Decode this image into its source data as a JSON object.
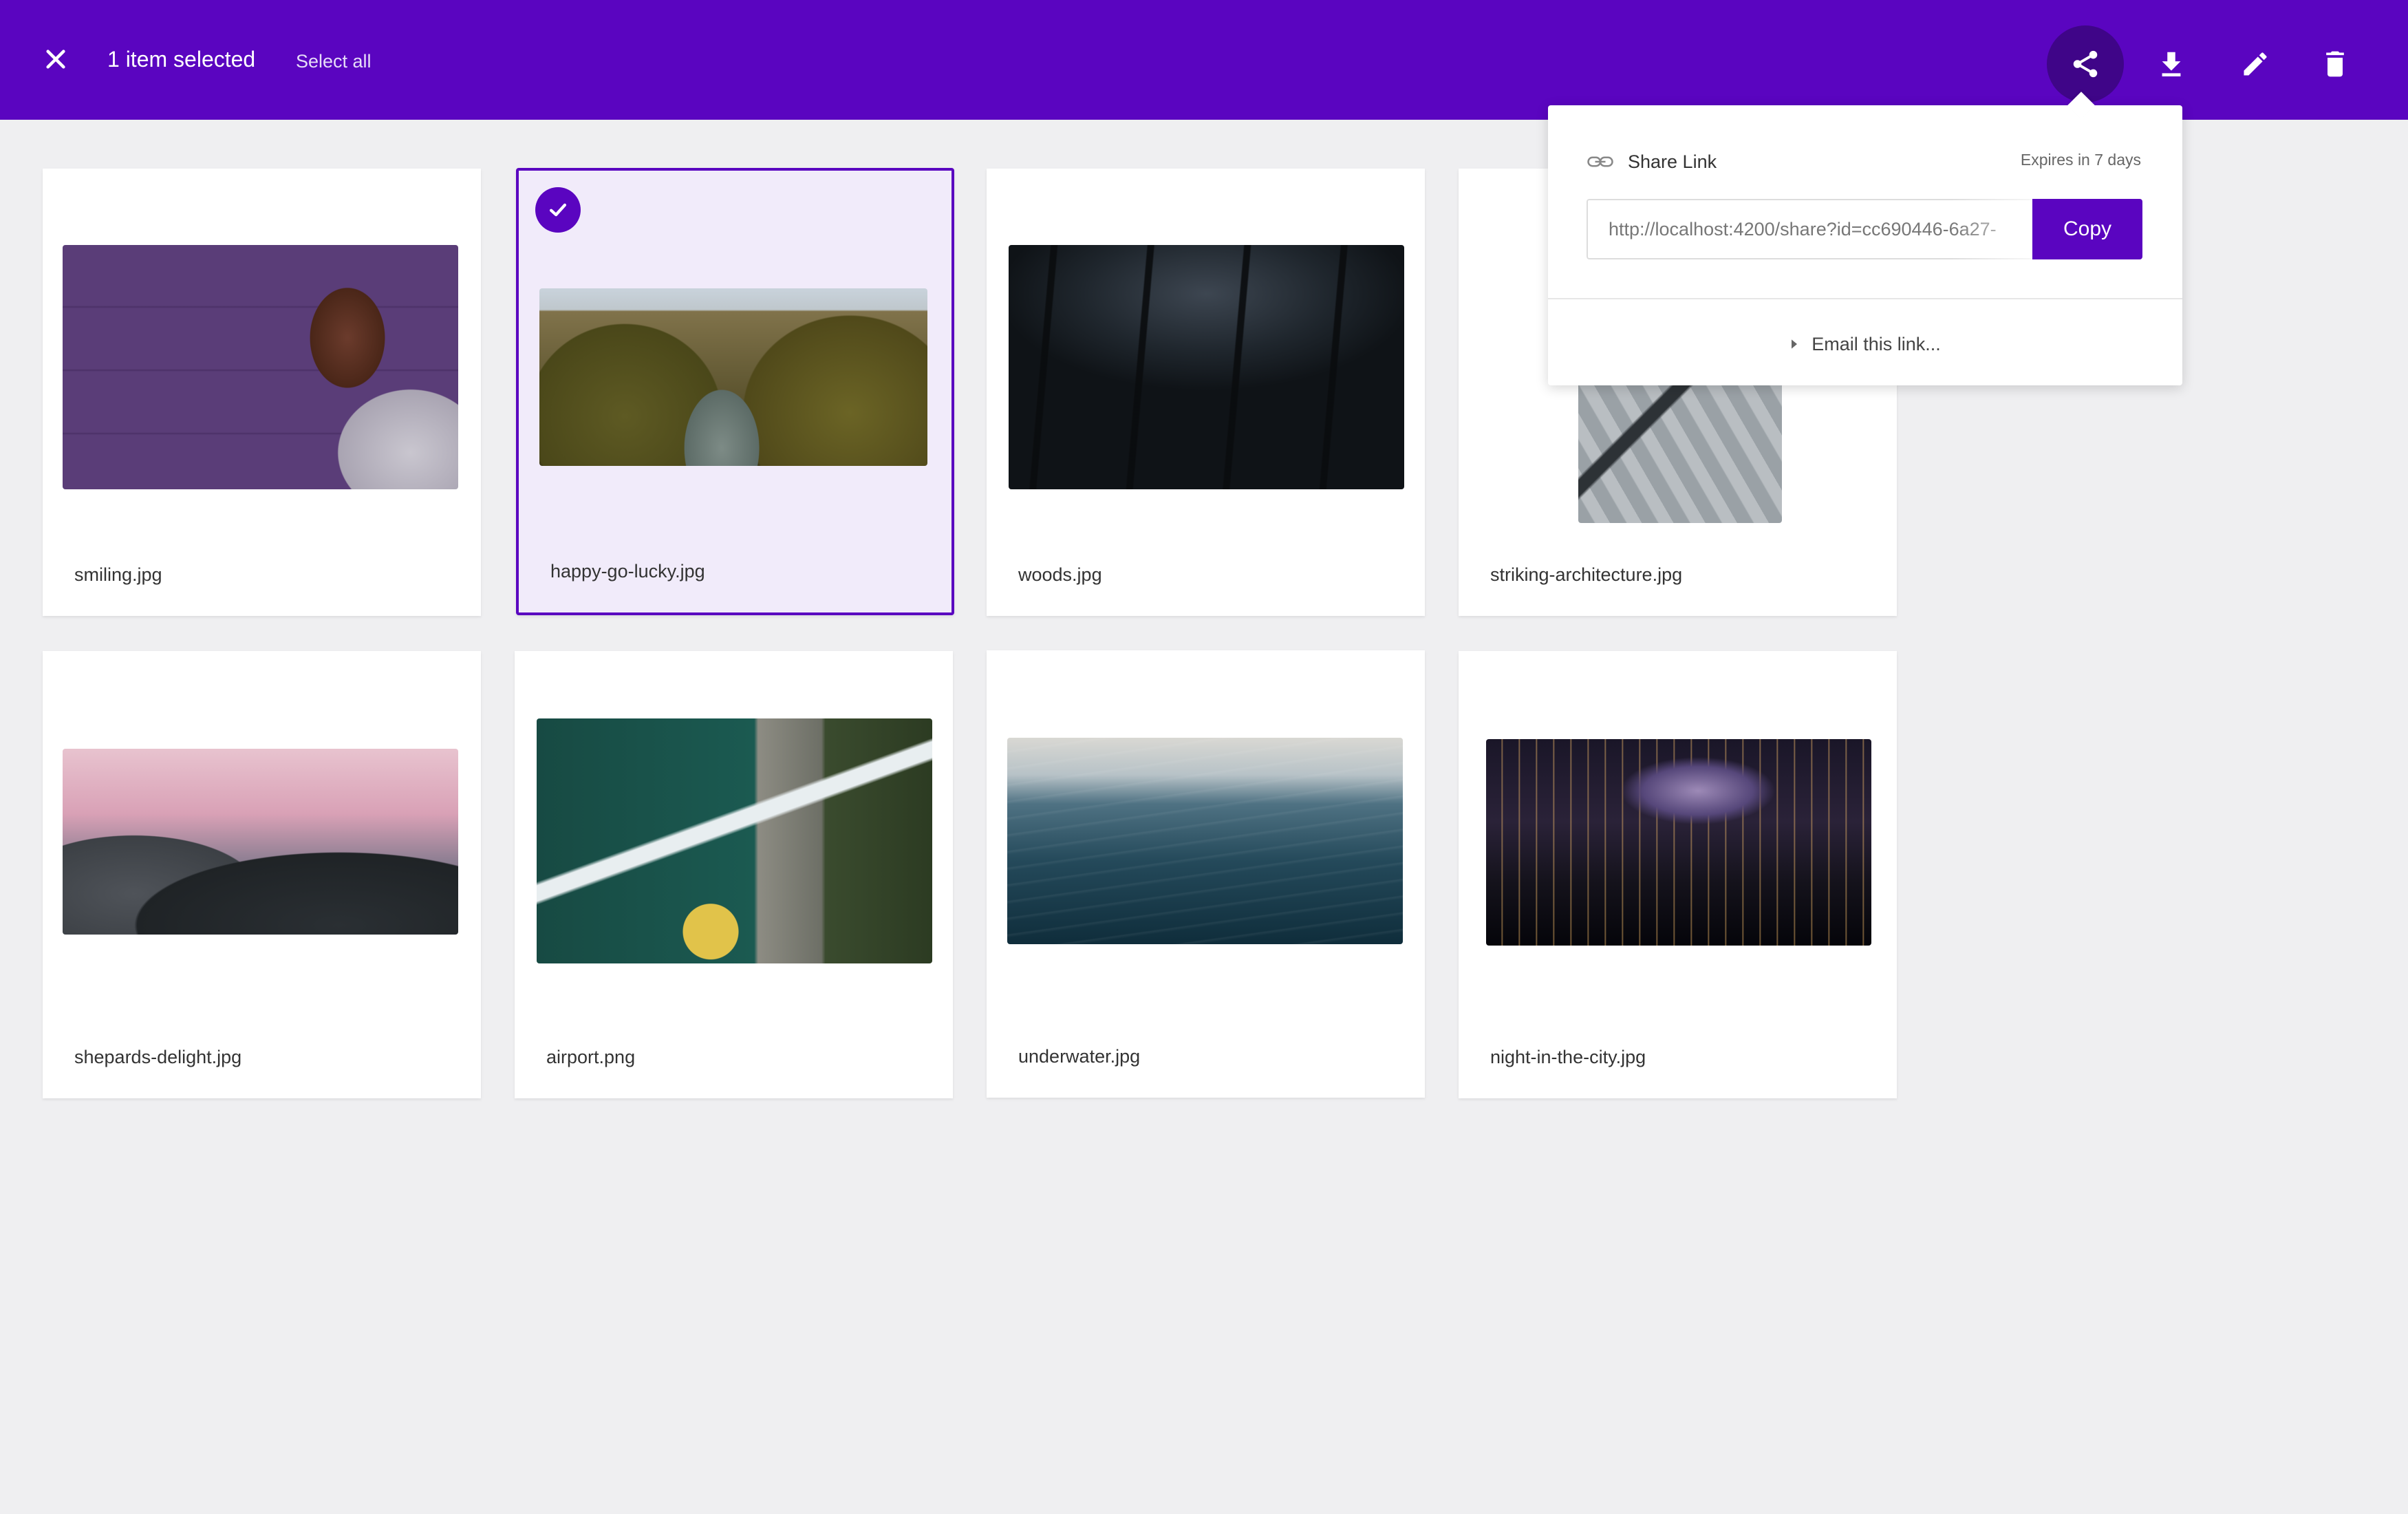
{
  "topbar": {
    "selection_count": "1 item selected",
    "select_all": "Select all",
    "background": "#5a05c0",
    "icons": {
      "close": "close-icon",
      "share": "share-icon",
      "download": "download-icon",
      "edit": "pencil-icon",
      "delete": "trash-icon"
    }
  },
  "files": [
    {
      "name": "smiling.jpg",
      "selected": false
    },
    {
      "name": "happy-go-lucky.jpg",
      "selected": true
    },
    {
      "name": "woods.jpg",
      "selected": false
    },
    {
      "name": "striking-architecture.jpg",
      "selected": false
    },
    {
      "name": "shepards-delight.jpg",
      "selected": false
    },
    {
      "name": "airport.png",
      "selected": false
    },
    {
      "name": "underwater.jpg",
      "selected": false
    },
    {
      "name": "night-in-the-city.jpg",
      "selected": false
    }
  ],
  "share_popover": {
    "title": "Share Link",
    "expires": "Expires in 7 days",
    "link": "http://localhost:4200/share?id=cc690446-6a27-",
    "copy_label": "Copy",
    "email_label": "Email this link..."
  },
  "colors": {
    "accent": "#5a05c0",
    "accent_dark": "#3f0588",
    "background": "#efeff1",
    "selected_card": "#f1ebfa"
  }
}
